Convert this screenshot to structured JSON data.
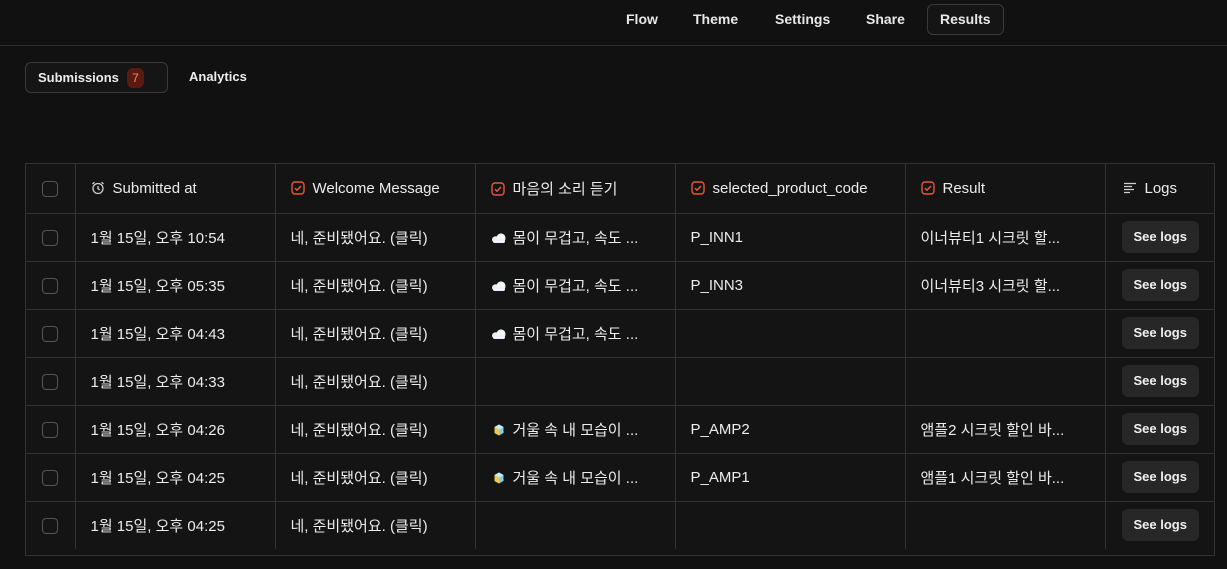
{
  "nav": {
    "items": [
      {
        "label": "Flow"
      },
      {
        "label": "Theme"
      },
      {
        "label": "Settings"
      },
      {
        "label": "Share"
      },
      {
        "label": "Results",
        "active": true
      }
    ]
  },
  "tabs": {
    "submissions_label": "Submissions",
    "submissions_count": "7",
    "analytics_label": "Analytics"
  },
  "table": {
    "headers": {
      "submitted_at": "Submitted at",
      "welcome": "Welcome Message",
      "voice": "마음의 소리 듣기",
      "product": "selected_product_code",
      "result": "Result",
      "logs": "Logs"
    },
    "see_logs_label": "See logs",
    "rows": [
      {
        "submitted_at": "1월 15일, 오후 10:54",
        "welcome": "네, 준비됐어요. (클릭)",
        "voice": "몸이 무겁고, 속도 ...",
        "voice_icon": "cloud-emoji",
        "product": "P_INN1",
        "result": "이너뷰티1 시크릿 할..."
      },
      {
        "submitted_at": "1월 15일, 오후 05:35",
        "welcome": "네, 준비됐어요. (클릭)",
        "voice": "몸이 무겁고, 속도 ...",
        "voice_icon": "cloud-emoji",
        "product": "P_INN3",
        "result": "이너뷰티3 시크릿 할..."
      },
      {
        "submitted_at": "1월 15일, 오후 04:43",
        "welcome": "네, 준비됐어요. (클릭)",
        "voice": "몸이 무겁고, 속도 ...",
        "voice_icon": "cloud-emoji",
        "product": "",
        "result": ""
      },
      {
        "submitted_at": "1월 15일, 오후 04:33",
        "welcome": "네, 준비됐어요. (클릭)",
        "voice": "",
        "voice_icon": "",
        "product": "",
        "result": ""
      },
      {
        "submitted_at": "1월 15일, 오후 04:26",
        "welcome": "네, 준비됐어요. (클릭)",
        "voice": "거울 속 내 모습이 ...",
        "voice_icon": "gem-emoji",
        "product": "P_AMP2",
        "result": "앰플2 시크릿 할인 바..."
      },
      {
        "submitted_at": "1월 15일, 오후 04:25",
        "welcome": "네, 준비됐어요. (클릭)",
        "voice": "거울 속 내 모습이 ...",
        "voice_icon": "gem-emoji",
        "product": "P_AMP1",
        "result": "앰플1 시크릿 할인 바..."
      },
      {
        "submitted_at": "1월 15일, 오후 04:25",
        "welcome": "네, 준비됐어요. (클릭)",
        "voice": "",
        "voice_icon": "",
        "product": "",
        "result": ""
      }
    ]
  },
  "colors": {
    "background": "#111111",
    "accent": "#e8563a",
    "badge_bg": "#5a1a10"
  }
}
